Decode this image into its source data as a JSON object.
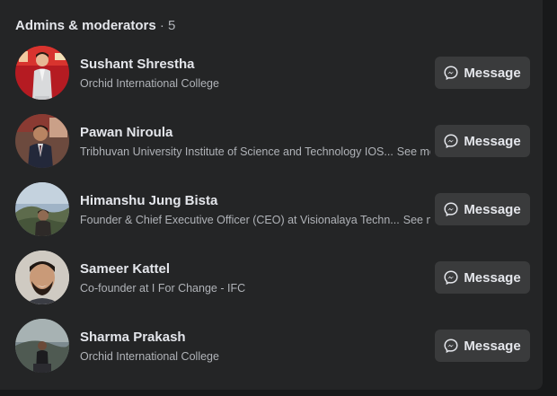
{
  "section": {
    "title": "Admins & moderators",
    "separator": " · ",
    "count": "5"
  },
  "members": [
    {
      "name": "Sushant Shrestha",
      "description": "Orchid International College",
      "see_more": "",
      "button_label": "Message"
    },
    {
      "name": "Pawan Niroula",
      "description": "Tribhuvan University Institute of Science and Technology IOS...",
      "see_more": "See more",
      "button_label": "Message"
    },
    {
      "name": "Himanshu Jung Bista",
      "description": "Founder & Chief Executive Officer (CEO) at Visionalaya Techn...",
      "see_more": "See more",
      "button_label": "Message"
    },
    {
      "name": "Sameer Kattel",
      "description": "Co-founder at I For Change - IFC",
      "see_more": "",
      "button_label": "Message"
    },
    {
      "name": "Sharma Prakash",
      "description": "Orchid International College",
      "see_more": "",
      "button_label": "Message"
    }
  ],
  "icons": {
    "message_button": "messenger-icon"
  },
  "colors": {
    "panel_background": "#242526",
    "page_background": "#18191a",
    "button_background": "#3a3b3c",
    "primary_text": "#e4e6eb",
    "secondary_text": "#b0b3b8"
  }
}
